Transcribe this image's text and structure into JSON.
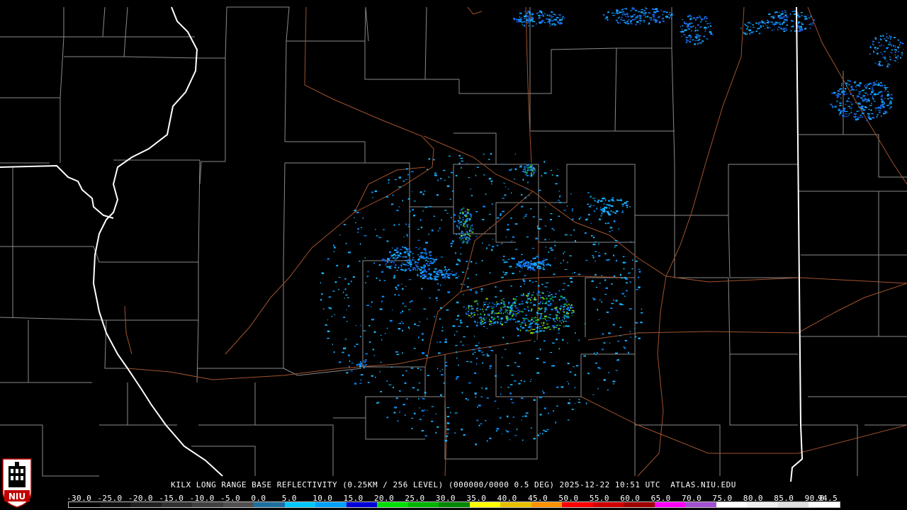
{
  "product": {
    "caption": "KILX LONG RANGE BASE REFLECTIVITY (0.25KM / 256 LEVEL) (000000/0000 0.5 DEG) 2025-12-22 10:51 UTC  ATLAS.NIU.EDU"
  },
  "logo": {
    "text": "NIU",
    "icon": "niu-tower-logo-icon"
  },
  "colorbar": {
    "labels": [
      "-30.0",
      "-25.0",
      "-20.0",
      "-15.0",
      "-10.0",
      "-5.0",
      "0.0",
      "5.0",
      "10.0",
      "15.0",
      "20.0",
      "25.0",
      "30.0",
      "35.0",
      "40.0",
      "45.0",
      "50.0",
      "55.0",
      "60.0",
      "65.0",
      "70.0",
      "75.0",
      "80.0",
      "85.0",
      "90.0",
      "94.5"
    ],
    "colors": [
      "#000000",
      "#101010",
      "#202020",
      "#303030",
      "#404040",
      "#505050",
      "#1e6fa0",
      "#00c8ff",
      "#00a0ff",
      "#0000d8",
      "#00e000",
      "#00b400",
      "#008800",
      "#ffff00",
      "#e6c000",
      "#ff9000",
      "#ff0000",
      "#d00000",
      "#a00000",
      "#ff00ff",
      "#a050d0",
      "#ffffff",
      "#f0f0f0",
      "#e0e0e0",
      "#ffffff"
    ]
  },
  "map": {
    "background": "#000000",
    "county_line_color": "#8a8a8a",
    "state_line_color": "#ffffff",
    "road_color": "#a0522d",
    "echo_colors": [
      "#19b4ff",
      "#0a8cff",
      "#1e5adc",
      "#00a050",
      "#8fd400"
    ]
  }
}
